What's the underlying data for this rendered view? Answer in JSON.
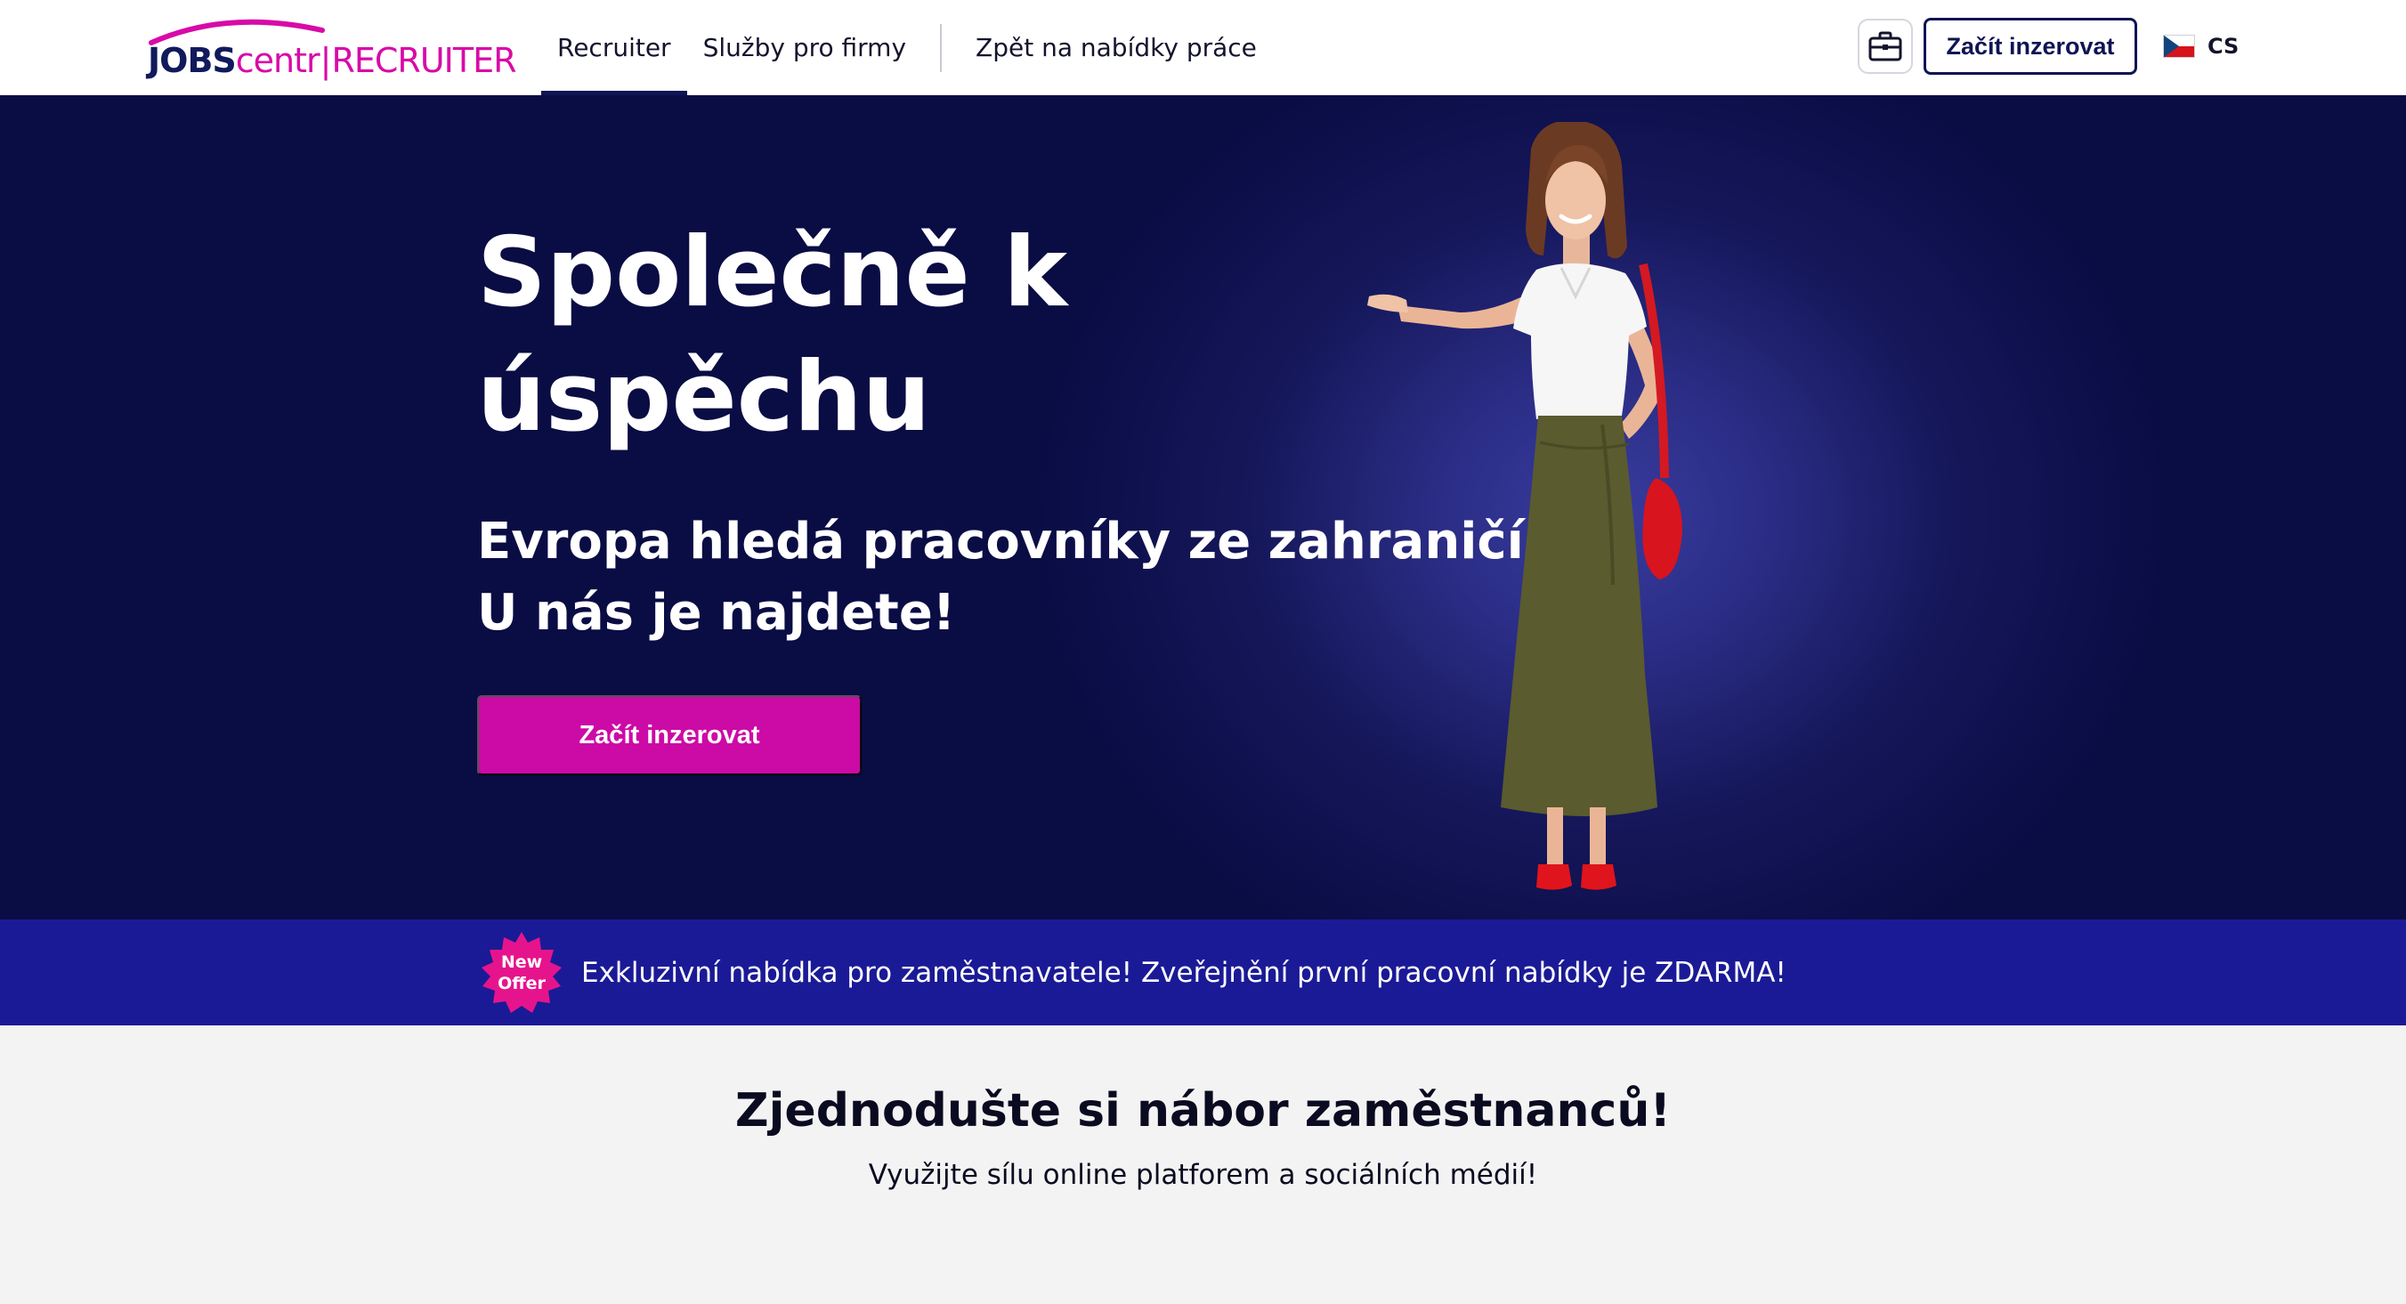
{
  "header": {
    "logo": {
      "jobs": "JOBS",
      "centr": "centr",
      "separator": "|",
      "recruiter": "RECRUITER"
    },
    "nav": [
      {
        "label": "Recruiter",
        "active": true
      },
      {
        "label": "Služby pro firmy",
        "active": false
      },
      {
        "label": "Zpět na nabídky práce",
        "active": false
      }
    ],
    "briefcase_icon": "briefcase-icon",
    "cta_label": "Začít inzerovat",
    "language": "CS",
    "flag_icon": "czech-flag-icon"
  },
  "hero": {
    "title_line1": "Společně k",
    "title_line2": "úspěchu",
    "subtitle_line1": "Evropa hledá pracovníky ze zahraničí.",
    "subtitle_line2": "U nás je najdete!",
    "cta_label": "Začít inzerovat"
  },
  "offer": {
    "badge_line1": "New",
    "badge_line2": "Offer",
    "text": "Exkluzivní nabídka pro zaměstnavatele! Zveřejnění první pracovní nabídky je ZDARMA!"
  },
  "section": {
    "title": "Zjednodušte si nábor zaměstnanců!",
    "subtitle": "Využijte sílu online platforem a sociálních médií!"
  },
  "colors": {
    "brand_navy": "#0f1454",
    "brand_magenta": "#cc0aa6",
    "hero_bg": "#0a0c44",
    "offer_bg": "#1b1a96"
  }
}
